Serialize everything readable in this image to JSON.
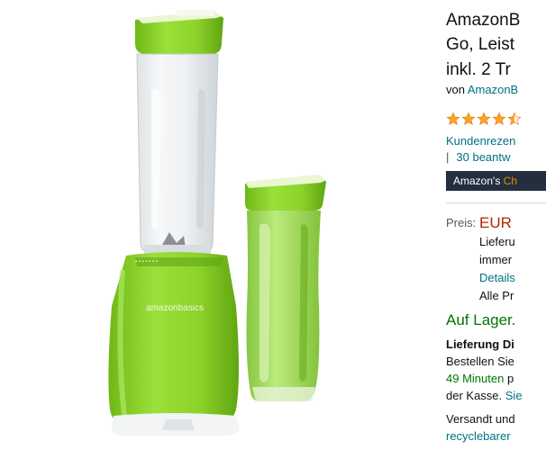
{
  "product": {
    "title_lines": [
      "AmazonB",
      "Go, Leist",
      "inkl. 2 Tr"
    ],
    "byline_prefix": "von ",
    "brand_link": "AmazonB",
    "review_link": "Kundenrezen",
    "answers_sep": "|",
    "answers_link": "30 beantw",
    "badge_prefix": "Amazon's ",
    "badge_highlight": "Ch",
    "rating_stars": 4.5
  },
  "price": {
    "label": "Preis:",
    "value": "EUR",
    "lines": [
      "Lieferu",
      "immer",
      "Details",
      "Alle Pr"
    ]
  },
  "availability": {
    "stock": "Auf Lager.",
    "delivery_title": "Lieferung Di",
    "order_text": "Bestellen Sie",
    "minutes": "49 Minuten",
    "minutes_suffix": " p",
    "checkout_text": "der Kasse. ",
    "checkout_link": "Sie",
    "shipped_by": "Versandt und",
    "recycle_link": "recyclebarer"
  },
  "image": {
    "brand_on_base": "amazonbasics"
  },
  "colors": {
    "accent_green": "#8fd12a",
    "link": "#007185",
    "price": "#b12704",
    "stock": "#007600",
    "star": "#ffa41c"
  }
}
